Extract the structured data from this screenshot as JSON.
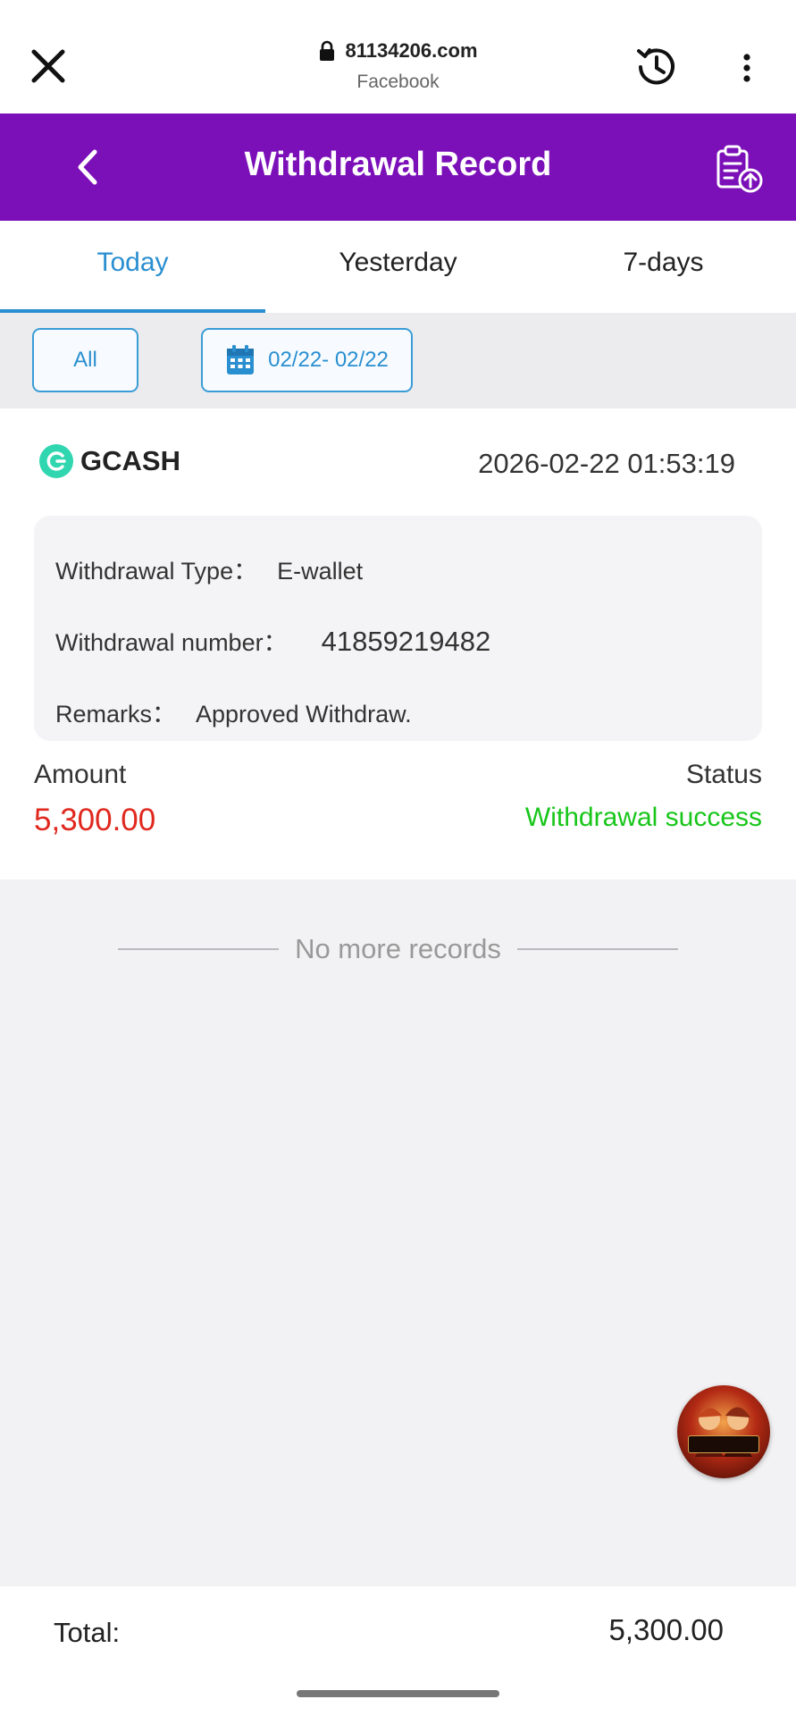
{
  "browser": {
    "domain": "81134206.com",
    "source": "Facebook"
  },
  "header": {
    "title": "Withdrawal Record"
  },
  "tabs": [
    {
      "label": "Today",
      "active": true
    },
    {
      "label": "Yesterday",
      "active": false
    },
    {
      "label": "7-days",
      "active": false
    }
  ],
  "filters": {
    "all_label": "All",
    "date_range": "02/22- 02/22"
  },
  "record": {
    "method": "GCASH",
    "datetime": "2026-02-22 01:53:19",
    "type_label": "Withdrawal Type：",
    "type_value": "E-wallet",
    "number_label": "Withdrawal number：",
    "number_value": "41859219482",
    "remarks_label": "Remarks：",
    "remarks_value": "Approved Withdraw.",
    "amount_label": "Amount",
    "amount_value": "5,300.00",
    "status_label": "Status",
    "status_value": "Withdrawal success"
  },
  "list_end_text": "No more records",
  "footer": {
    "total_label": "Total:",
    "total_value": "5,300.00"
  },
  "colors": {
    "header_bg": "#7b0fb8",
    "accent_blue": "#2a8fd0",
    "amount_red": "#e0281e",
    "success_green": "#18c61a"
  }
}
